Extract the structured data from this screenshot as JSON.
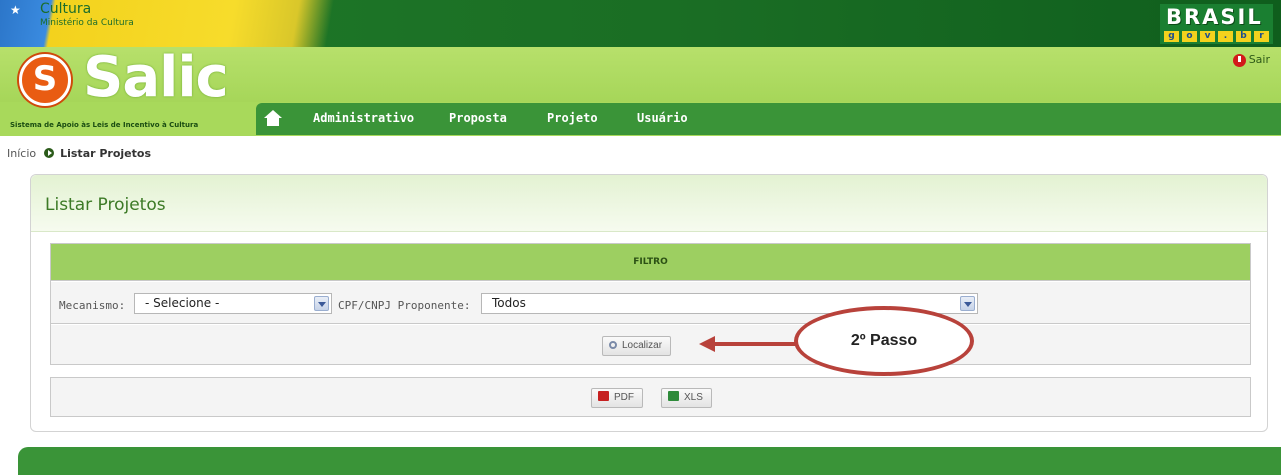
{
  "gov": {
    "cultura": "Cultura",
    "ministerio": "Ministério da Cultura",
    "brasil": "BRASIL",
    "brasil_domain": [
      "g",
      "o",
      "v",
      ".",
      "b",
      "r"
    ]
  },
  "header": {
    "logo_text": "Salic",
    "logo_letter": "S",
    "tagline": "Sistema de Apoio às Leis de Incentivo à Cultura",
    "sair": "Sair"
  },
  "nav": {
    "items": [
      "Administrativo",
      "Proposta",
      "Projeto",
      "Usuário"
    ]
  },
  "breadcrumb": {
    "home": "Início",
    "current": "Listar Projetos"
  },
  "panel": {
    "title": "Listar Projetos",
    "filter_header": "FILTRO",
    "mecanismo_label": "Mecanismo:",
    "mecanismo_value": "- Selecione -",
    "cpf_label": "CPF/CNPJ Proponente:",
    "cpf_value": "Todos",
    "localizar": "Localizar",
    "pdf": "PDF",
    "xls": "XLS"
  },
  "annotation": {
    "text": "2º Passo",
    "color": "#b8423b"
  },
  "colors": {
    "nav_green": "#3a9438",
    "header_green": "#a8d95b",
    "filter_green": "#9dcf61",
    "title_green": "#3c7a26"
  }
}
